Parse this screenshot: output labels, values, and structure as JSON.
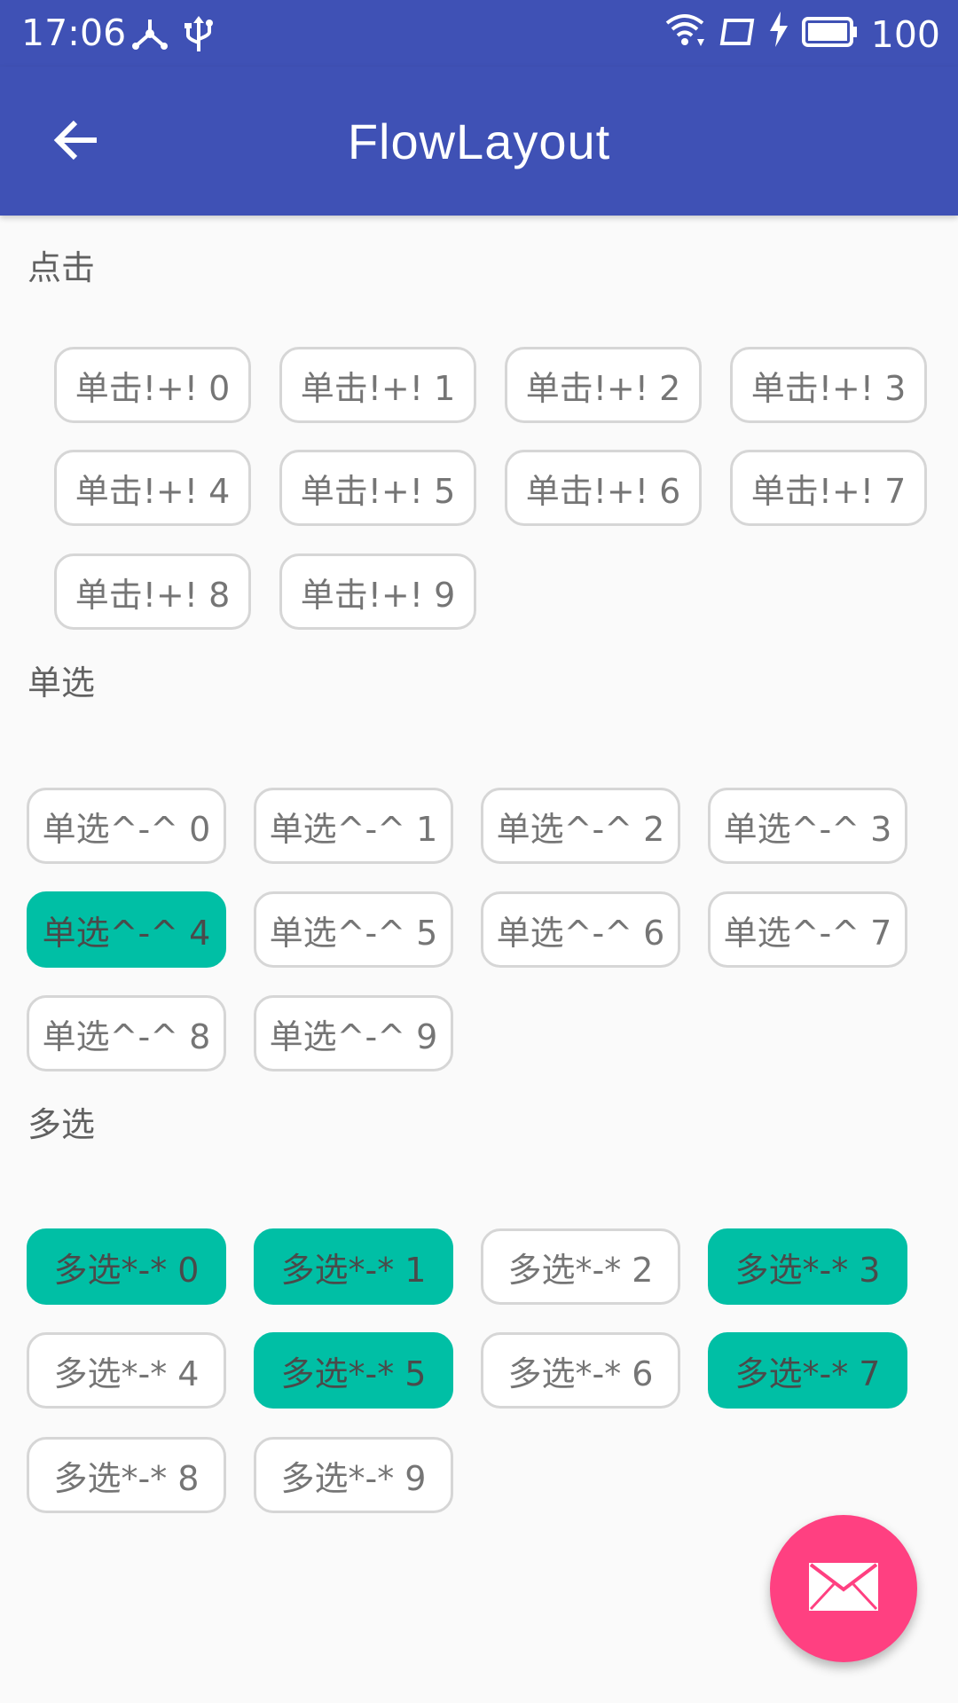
{
  "status_bar": {
    "time": "17:06",
    "battery": "100"
  },
  "app_bar": {
    "title": "FlowLayout"
  },
  "sections": {
    "click": {
      "label": "点击",
      "items": [
        "单击!+! 0",
        "单击!+! 1",
        "单击!+! 2",
        "单击!+! 3",
        "单击!+! 4",
        "单击!+! 5",
        "单击!+! 6",
        "单击!+! 7",
        "单击!+! 8",
        "单击!+! 9"
      ]
    },
    "single": {
      "label": "单选",
      "items": [
        "单选^-^ 0",
        "单选^-^ 1",
        "单选^-^ 2",
        "单选^-^ 3",
        "单选^-^ 4",
        "单选^-^ 5",
        "单选^-^ 6",
        "单选^-^ 7",
        "单选^-^ 8",
        "单选^-^ 9"
      ],
      "selected": [
        4
      ]
    },
    "multi": {
      "label": "多选",
      "items": [
        "多选*-* 0",
        "多选*-* 1",
        "多选*-* 2",
        "多选*-* 3",
        "多选*-* 4",
        "多选*-* 5",
        "多选*-* 6",
        "多选*-* 7",
        "多选*-* 8",
        "多选*-* 9"
      ],
      "selected": [
        0,
        1,
        3,
        5,
        7
      ]
    }
  },
  "colors": {
    "primary": "#3f51b5",
    "selected_chip": "#00bfa5",
    "fab": "#ff4081"
  },
  "icons": {
    "back": "arrow-back-icon",
    "fab": "mail-icon"
  }
}
